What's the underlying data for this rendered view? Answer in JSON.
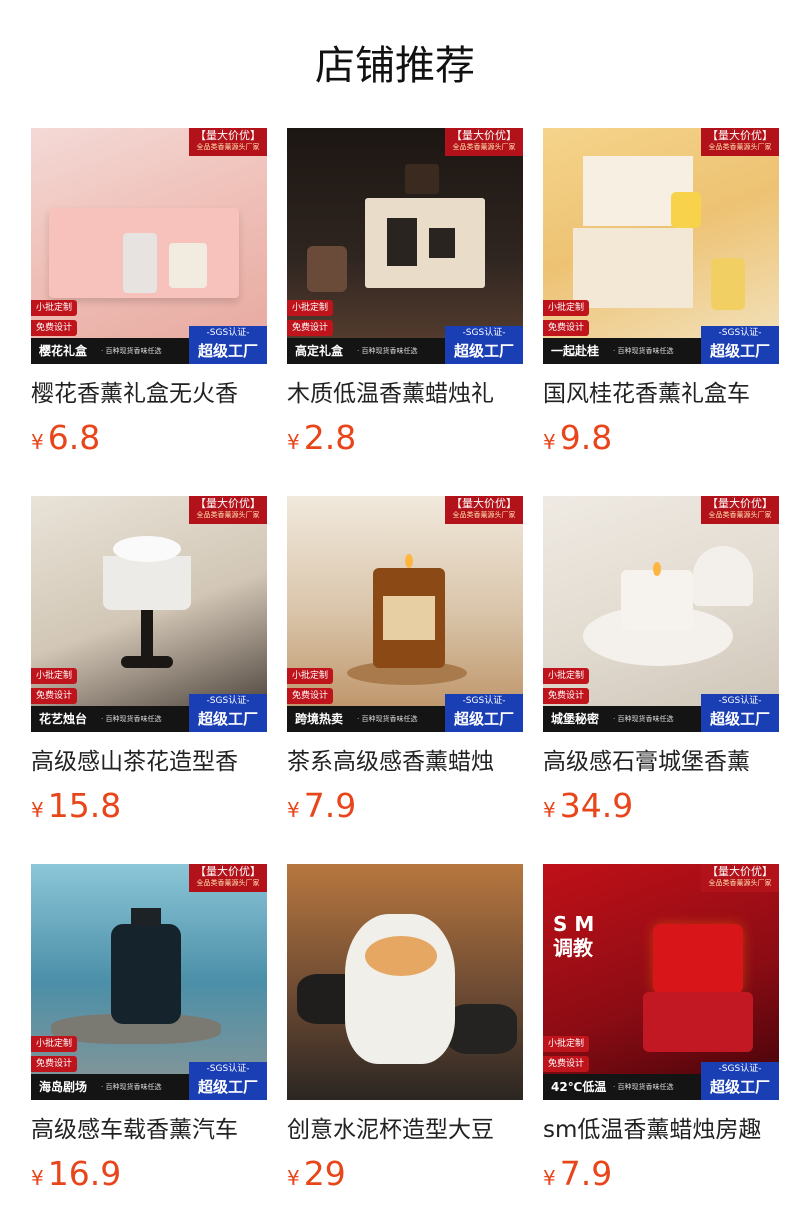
{
  "page": {
    "title": "店铺推荐"
  },
  "badges": {
    "ribbon_top": "【量大价优】",
    "ribbon_sub": "全品类香薰源头厂家",
    "tag_small_batch": "小批定制",
    "tag_free_design": "免费设计",
    "sgs": "-SGS认证-",
    "factory": "超级工厂",
    "bar_text": "· 百种现货香味任选"
  },
  "currency": "¥",
  "products": [
    {
      "caption": "樱花礼盒",
      "name": "樱花香薰礼盒无火香",
      "price": "6.8"
    },
    {
      "caption": "高定礼盒",
      "name": "木质低温香薰蜡烛礼",
      "price": "2.8"
    },
    {
      "caption": "一起赴桂",
      "name": "国风桂花香薰礼盒车",
      "price": "9.8"
    },
    {
      "caption": "花艺烛台",
      "name": "高级感山茶花造型香",
      "price": "15.8"
    },
    {
      "caption": "跨境热卖",
      "name": "茶系高级感香薰蜡烛",
      "price": "7.9"
    },
    {
      "caption": "城堡秘密",
      "name": "高级感石膏城堡香薰",
      "price": "34.9"
    },
    {
      "caption": "海岛剧场",
      "name": "高级感车载香薰汽车",
      "price": "16.9"
    },
    {
      "caption": "",
      "name": "创意水泥杯造型大豆",
      "price": "29"
    },
    {
      "caption": "42℃低温",
      "name": "sm低温香薰蜡烛房趣",
      "price": "7.9"
    }
  ],
  "product9_overlay": {
    "line1": "S M",
    "line2": "调教"
  }
}
